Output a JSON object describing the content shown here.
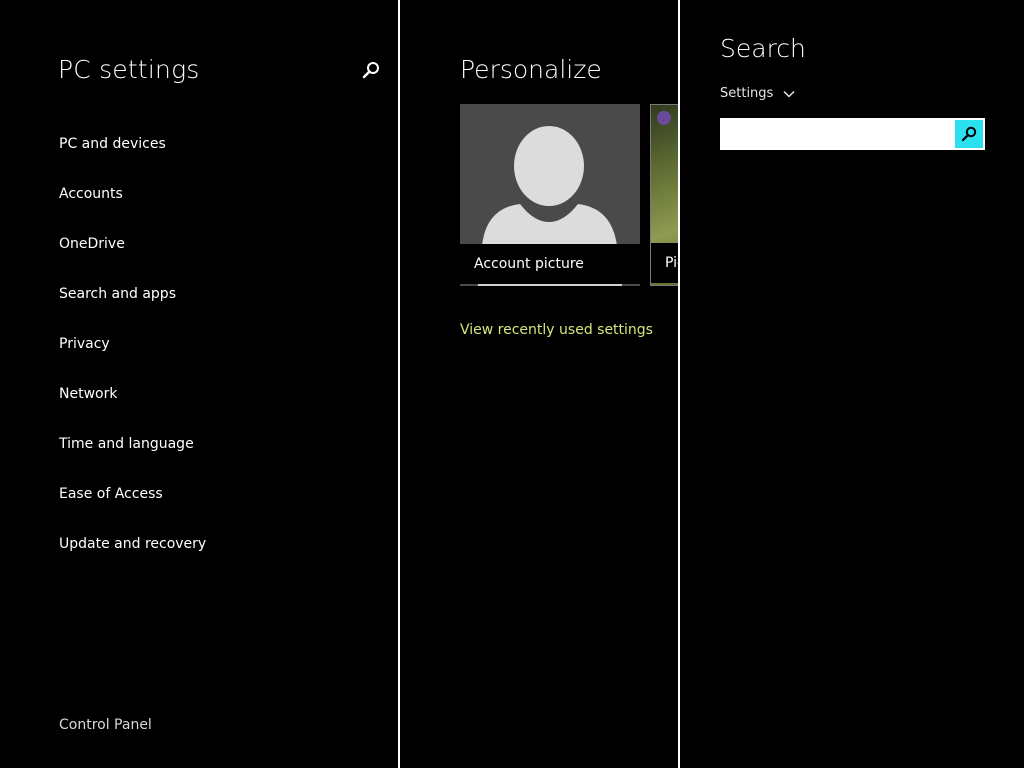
{
  "nav": {
    "title": "PC settings",
    "items": [
      {
        "label": "PC and devices"
      },
      {
        "label": "Accounts"
      },
      {
        "label": "OneDrive"
      },
      {
        "label": "Search and apps"
      },
      {
        "label": "Privacy"
      },
      {
        "label": "Network"
      },
      {
        "label": "Time and language"
      },
      {
        "label": "Ease of Access"
      },
      {
        "label": "Update and recovery"
      }
    ],
    "control_panel_label": "Control Panel",
    "search_icon": "search-icon"
  },
  "personalize": {
    "title": "Personalize",
    "tiles": [
      {
        "label": "Account picture",
        "icon": "user-silhouette-icon"
      },
      {
        "label": "Picture password"
      }
    ],
    "recent_link_label": "View recently used settings",
    "link_color": "#d9e57a"
  },
  "search": {
    "title": "Search",
    "scope_label": "Settings",
    "input_value": "",
    "button_color": "#2de0f0",
    "button_icon": "search-icon"
  }
}
